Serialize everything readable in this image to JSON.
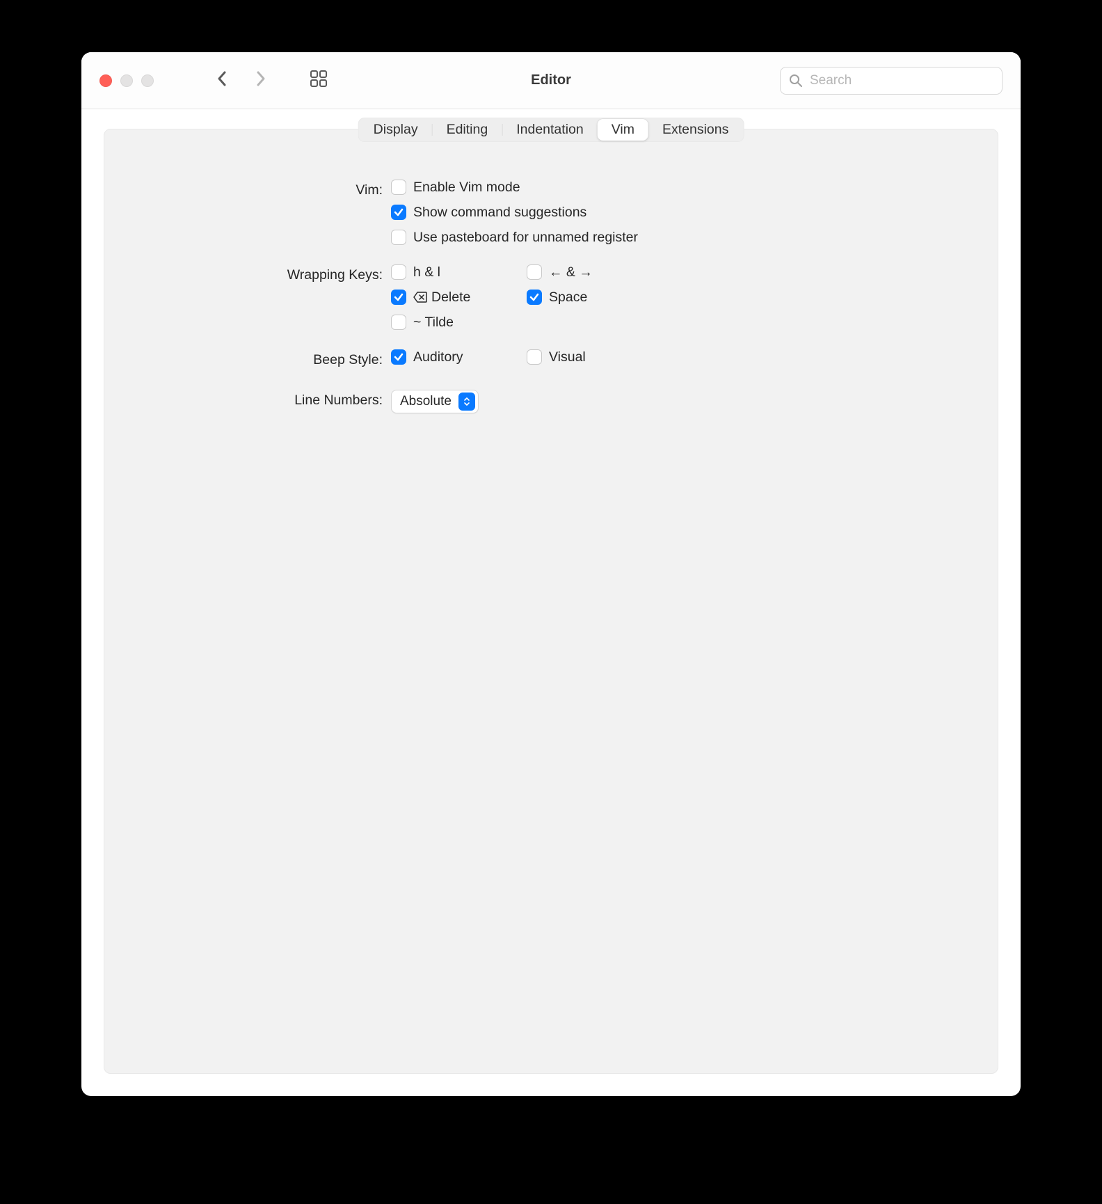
{
  "window": {
    "title": "Editor",
    "search_placeholder": "Search"
  },
  "tabs": [
    {
      "label": "Display",
      "active": false
    },
    {
      "label": "Editing",
      "active": false
    },
    {
      "label": "Indentation",
      "active": false
    },
    {
      "label": "Vim",
      "active": true
    },
    {
      "label": "Extensions",
      "active": false
    }
  ],
  "sections": {
    "vim": {
      "label": "Vim:",
      "items": [
        {
          "label": "Enable Vim mode",
          "checked": false
        },
        {
          "label": "Show command suggestions",
          "checked": true
        },
        {
          "label": "Use pasteboard for unnamed register",
          "checked": false
        }
      ]
    },
    "wrapping": {
      "label": "Wrapping Keys:",
      "col1": [
        {
          "label": "h & l",
          "checked": false,
          "icon": null
        },
        {
          "label": "Delete",
          "checked": true,
          "icon": "backspace"
        },
        {
          "label": "~ Tilde",
          "checked": false,
          "icon": null
        }
      ],
      "col2": [
        {
          "label": "← & →",
          "checked": false,
          "icon": null
        },
        {
          "label": "Space",
          "checked": true,
          "icon": null
        }
      ]
    },
    "beep": {
      "label": "Beep Style:",
      "items": [
        {
          "label": "Auditory",
          "checked": true
        },
        {
          "label": "Visual",
          "checked": false
        }
      ]
    },
    "linenumbers": {
      "label": "Line Numbers:",
      "value": "Absolute"
    }
  }
}
